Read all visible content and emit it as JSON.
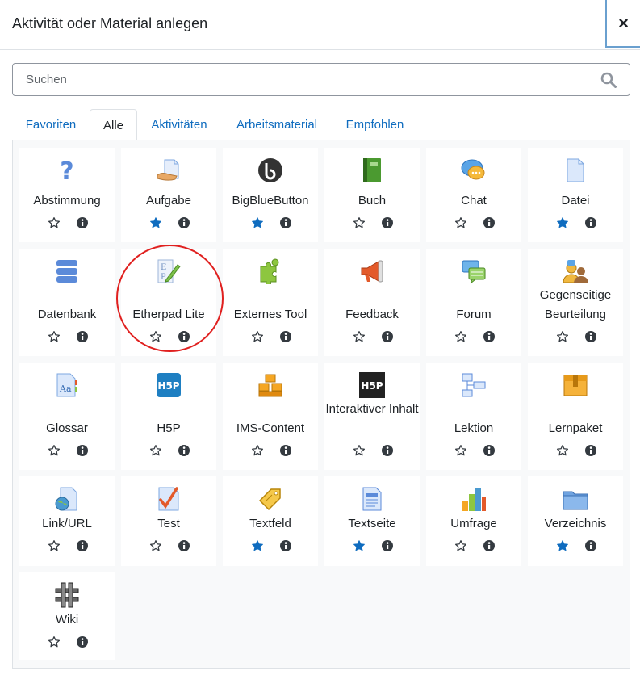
{
  "dialog": {
    "title": "Aktivität oder Material anlegen",
    "close_symbol": "×"
  },
  "search": {
    "placeholder": "Suchen",
    "value": ""
  },
  "tabs": [
    {
      "label": "Favoriten",
      "active": false
    },
    {
      "label": "Alle",
      "active": true
    },
    {
      "label": "Aktivitäten",
      "active": false
    },
    {
      "label": "Arbeitsmaterial",
      "active": false
    },
    {
      "label": "Empfohlen",
      "active": false
    }
  ],
  "colors": {
    "accent": "#0f6cbf",
    "star_filled": "#0f6cbf",
    "highlight_circle": "#e0201f"
  },
  "modules": [
    {
      "label": "Abstimmung",
      "icon": "question-icon",
      "starred": false
    },
    {
      "label": "Aufgabe",
      "icon": "assignment-icon",
      "starred": true
    },
    {
      "label": "BigBlueButton",
      "icon": "bigbluebutton-icon",
      "starred": true
    },
    {
      "label": "Buch",
      "icon": "book-icon",
      "starred": false
    },
    {
      "label": "Chat",
      "icon": "chat-icon",
      "starred": false
    },
    {
      "label": "Datei",
      "icon": "file-icon",
      "starred": true
    },
    {
      "label": "Datenbank",
      "icon": "database-icon",
      "starred": false
    },
    {
      "label": "Etherpad Lite",
      "icon": "etherpad-icon",
      "starred": false,
      "highlighted": true
    },
    {
      "label": "Externes Tool",
      "icon": "puzzle-icon",
      "starred": false
    },
    {
      "label": "Feedback",
      "icon": "megaphone-icon",
      "starred": false
    },
    {
      "label": "Forum",
      "icon": "forum-icon",
      "starred": false
    },
    {
      "label": "Gegenseitige Beurteilung",
      "icon": "workshop-icon",
      "starred": false
    },
    {
      "label": "Glossar",
      "icon": "glossary-icon",
      "starred": false
    },
    {
      "label": "H5P",
      "icon": "h5p-icon",
      "starred": false
    },
    {
      "label": "IMS-Content",
      "icon": "ims-content-icon",
      "starred": false
    },
    {
      "label": "Interaktiver Inhalt",
      "icon": "h5p-interactive-icon",
      "starred": false
    },
    {
      "label": "Lektion",
      "icon": "lesson-icon",
      "starred": false
    },
    {
      "label": "Lernpaket",
      "icon": "package-icon",
      "starred": false
    },
    {
      "label": "Link/URL",
      "icon": "url-icon",
      "starred": false
    },
    {
      "label": "Test",
      "icon": "quiz-icon",
      "starred": false
    },
    {
      "label": "Textfeld",
      "icon": "label-tag-icon",
      "starred": true
    },
    {
      "label": "Textseite",
      "icon": "page-icon",
      "starred": true
    },
    {
      "label": "Umfrage",
      "icon": "survey-chart-icon",
      "starred": false
    },
    {
      "label": "Verzeichnis",
      "icon": "folder-icon",
      "starred": true
    },
    {
      "label": "Wiki",
      "icon": "wiki-icon",
      "starred": false
    }
  ]
}
